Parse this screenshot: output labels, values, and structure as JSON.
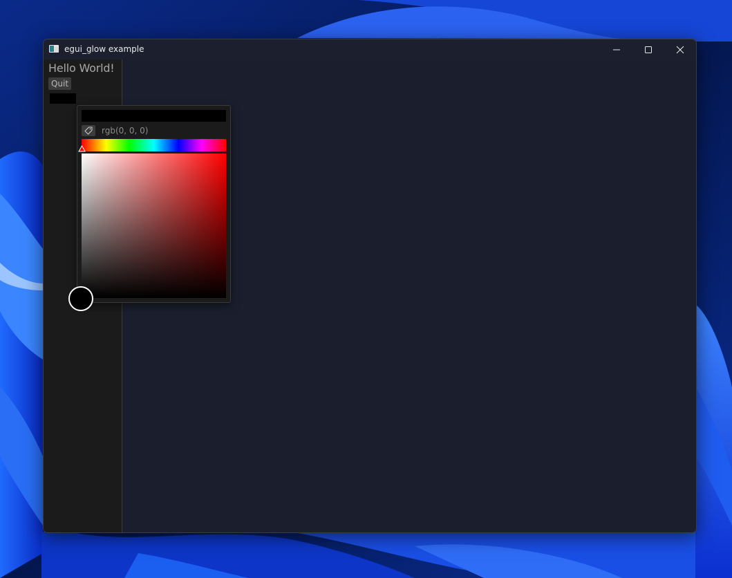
{
  "window": {
    "title": "egui_glow example",
    "minimize_label": "minimize",
    "maximize_label": "maximize",
    "close_label": "close"
  },
  "side_panel": {
    "heading": "Hello World!",
    "quit_label": "Quit"
  },
  "color_picker": {
    "rgb_text": "rgb(0, 0, 0)",
    "current_color": "#000000",
    "hue": 0,
    "saturation": 0,
    "value": 0
  },
  "colors": {
    "window_bg": "#1b1f2d",
    "panel_bg": "#1b1b1b",
    "button_bg": "#3c3c3c",
    "text_dim": "#a7a7a7"
  }
}
